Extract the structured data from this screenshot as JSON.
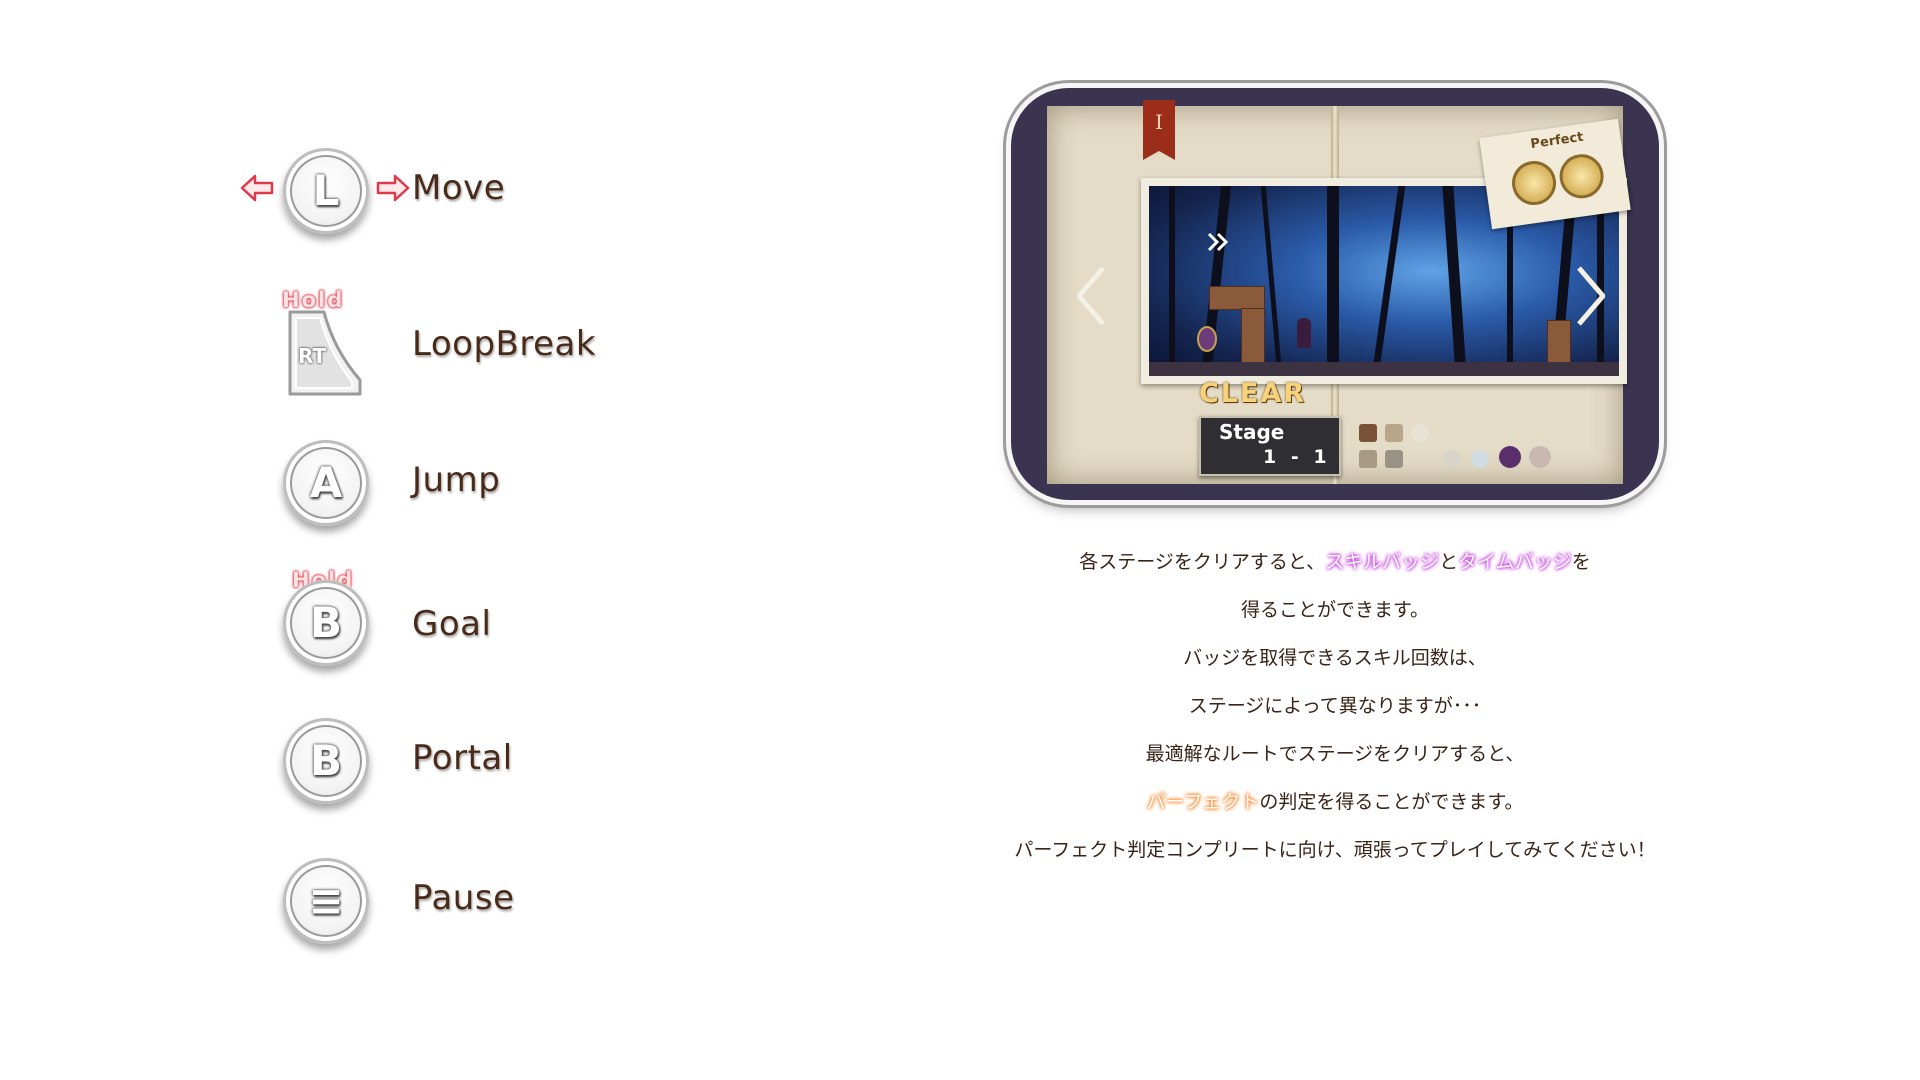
{
  "controls": [
    {
      "id": "move",
      "glyph": "L",
      "label": "Move",
      "hold": ""
    },
    {
      "id": "loopbreak",
      "glyph": "RT",
      "label": "LoopBreak",
      "hold": "Hold"
    },
    {
      "id": "jump",
      "glyph": "A",
      "label": "Jump",
      "hold": ""
    },
    {
      "id": "goal",
      "glyph": "B",
      "label": "Goal",
      "hold": "Hold"
    },
    {
      "id": "portal",
      "glyph": "B",
      "label": "Portal",
      "hold": ""
    },
    {
      "id": "pause",
      "glyph": "≡",
      "label": "Pause",
      "hold": ""
    }
  ],
  "screenshot": {
    "bookmark": "I",
    "badge_label": "Perfect",
    "clear_text": "CLEAR",
    "stage_label": "Stage",
    "stage_number": "1 - 1"
  },
  "description": {
    "line1_pre": "各ステージをクリアすると、",
    "line1_skill": "スキルバッジ",
    "line1_mid": "と",
    "line1_time": "タイムバッジ",
    "line1_post": "を",
    "line2": "得ることができます。",
    "line3": "バッジを取得できるスキル回数は、",
    "line4": "ステージによって異なりますが･･･",
    "line5": "最適解なルートでステージをクリアすると、",
    "line6_perfect": "パーフェクト",
    "line6_post": "の判定を得ることができます。",
    "line7": "パーフェクト判定コンプリートに向け、頑張ってプレイしてみてください！"
  },
  "colors": {
    "label_text": "#4a2b1a",
    "hold_glow": "#e0394b",
    "skill_highlight": "#c42fe0",
    "perfect_highlight": "#ff7a1a"
  }
}
